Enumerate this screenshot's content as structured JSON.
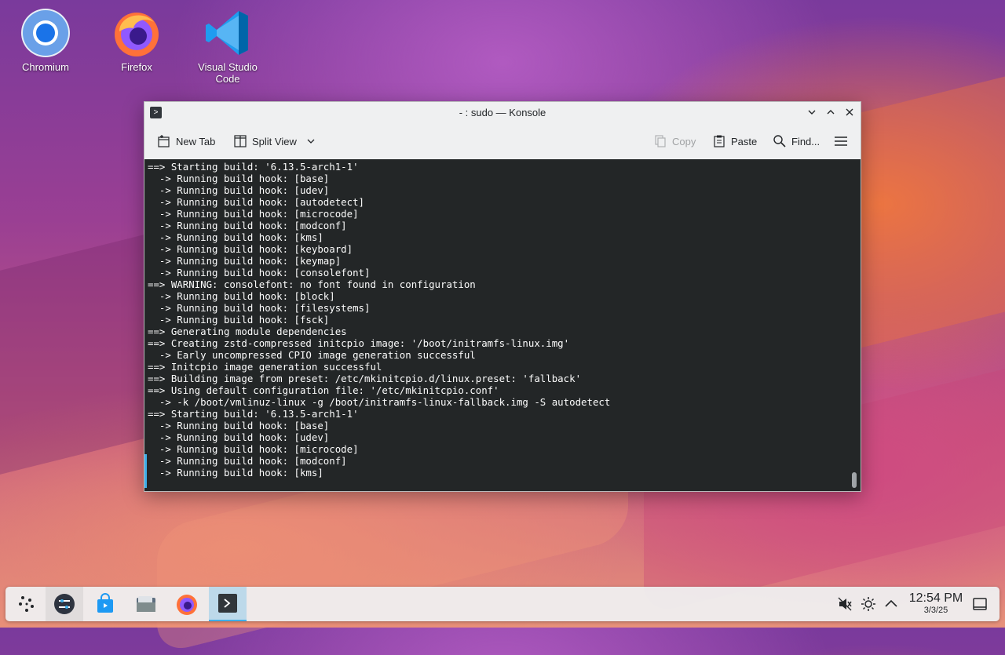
{
  "desktop": {
    "icons": [
      {
        "label": "Chromium"
      },
      {
        "label": "Firefox"
      },
      {
        "label": "Visual Studio Code"
      }
    ]
  },
  "window": {
    "title": "- : sudo — Konsole",
    "toolbar": {
      "new_tab": "New Tab",
      "split_view": "Split View",
      "copy": "Copy",
      "paste": "Paste",
      "find": "Find..."
    },
    "terminal_lines": [
      "==> Starting build: '6.13.5-arch1-1'",
      "  -> Running build hook: [base]",
      "  -> Running build hook: [udev]",
      "  -> Running build hook: [autodetect]",
      "  -> Running build hook: [microcode]",
      "  -> Running build hook: [modconf]",
      "  -> Running build hook: [kms]",
      "  -> Running build hook: [keyboard]",
      "  -> Running build hook: [keymap]",
      "  -> Running build hook: [consolefont]",
      "==> WARNING: consolefont: no font found in configuration",
      "  -> Running build hook: [block]",
      "  -> Running build hook: [filesystems]",
      "  -> Running build hook: [fsck]",
      "==> Generating module dependencies",
      "==> Creating zstd-compressed initcpio image: '/boot/initramfs-linux.img'",
      "  -> Early uncompressed CPIO image generation successful",
      "==> Initcpio image generation successful",
      "==> Building image from preset: /etc/mkinitcpio.d/linux.preset: 'fallback'",
      "==> Using default configuration file: '/etc/mkinitcpio.conf'",
      "  -> -k /boot/vmlinuz-linux -g /boot/initramfs-linux-fallback.img -S autodetect",
      "==> Starting build: '6.13.5-arch1-1'",
      "  -> Running build hook: [base]",
      "  -> Running build hook: [udev]",
      "  -> Running build hook: [microcode]",
      "  -> Running build hook: [modconf]",
      "  -> Running build hook: [kms]"
    ]
  },
  "taskbar": {
    "clock_time": "12:54 PM",
    "clock_date": "3/3/25"
  },
  "colors": {
    "accent": "#3daee9",
    "terminal_bg": "#232627",
    "terminal_fg": "#fcfcfc"
  }
}
